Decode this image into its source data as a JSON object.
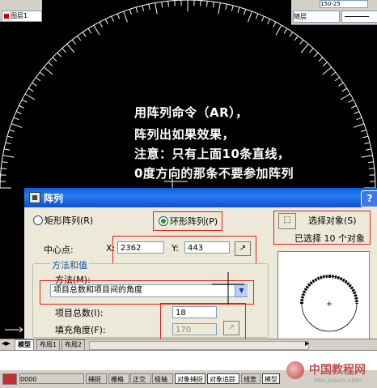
{
  "toolbar": {
    "layer_value": "图层1",
    "layer_combo_right": "随层",
    "top_small_value": "150-25"
  },
  "annotation": {
    "line1": "用阵列命令（AR），",
    "line2": "阵列出如果效果，",
    "line3": "注意：只有上面10条直线，",
    "line4": "0度方向的那条不要参加阵列"
  },
  "dialog": {
    "title": "阵列",
    "help": "?",
    "rect_array_label": "矩形阵列(R)",
    "polar_array_label": "环形阵列(P)",
    "select_objects_label": "选择对象(S)",
    "selected_count_text": "已选择 10 个对象",
    "center_label": "中心点:",
    "x_label": "X:",
    "x_value": "2362",
    "y_label": "Y:",
    "y_value": "443",
    "method_group_label": "方法和值",
    "method_label": "方法(M):",
    "method_value": "项目总数和项目间的角度",
    "items_label": "项目总数(I):",
    "items_value": "18",
    "fill_angle_label": "填充角度(F):",
    "fill_angle_value": "170"
  },
  "layout_tabs": [
    "模型",
    "布局1",
    "布局2"
  ],
  "status": {
    "coords": "0000",
    "buttons": [
      "捕捉",
      "栅格",
      "正交",
      "极轴",
      "对象捕捉",
      "对象追踪",
      "线宽",
      "模型"
    ],
    "active": [
      false,
      false,
      false,
      false,
      true,
      true,
      false,
      true
    ]
  },
  "watermark": {
    "name": "中国教程网",
    "url": "bbs.jcwcn.com"
  },
  "colors": {
    "titlebar": "#0a5ee0",
    "highlight": "#e02020",
    "radio_on": "#21a121"
  }
}
